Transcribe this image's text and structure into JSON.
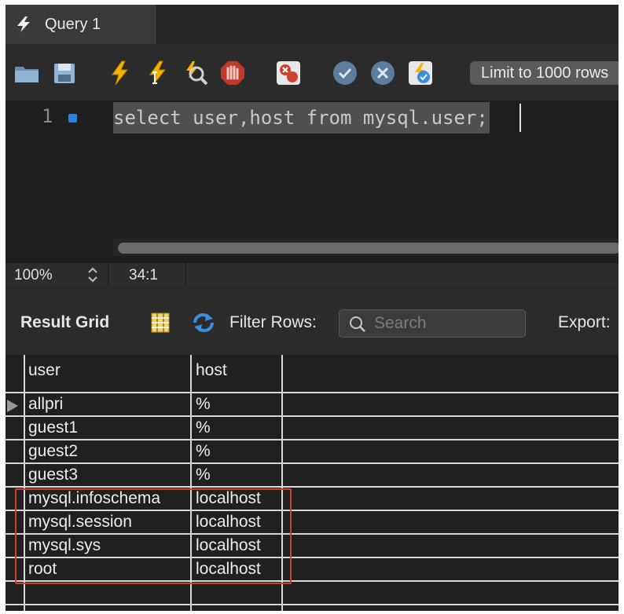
{
  "tab": {
    "title": "Query 1",
    "icon": "lightning-icon"
  },
  "toolbar": {
    "icons": [
      "folder-icon",
      "save-icon",
      "execute-icon",
      "execute-statement-icon",
      "explain-icon",
      "stop-icon",
      "toggle-error-stop-icon",
      "commit-icon",
      "rollback-icon",
      "autocommit-icon"
    ],
    "limit_label": "Limit to 1000 rows"
  },
  "editor": {
    "line_number": "1",
    "sql": "select user,host from mysql.user;"
  },
  "status": {
    "zoom": "100%",
    "position": "34:1"
  },
  "result_toolbar": {
    "result_grid_label": "Result Grid",
    "filter_label": "Filter Rows:",
    "search_placeholder": "Search",
    "export_label": "Export:"
  },
  "grid": {
    "columns": [
      "user",
      "host"
    ],
    "rows": [
      [
        "allpri",
        "%"
      ],
      [
        "guest1",
        "%"
      ],
      [
        "guest2",
        "%"
      ],
      [
        "guest3",
        "%"
      ],
      [
        "mysql.infoschema",
        "localhost"
      ],
      [
        "mysql.session",
        "localhost"
      ],
      [
        "mysql.sys",
        "localhost"
      ],
      [
        "root",
        "localhost"
      ]
    ],
    "current_row": 0
  },
  "colors": {
    "highlight": "#d0402f",
    "accent": "#2d7fe0"
  }
}
